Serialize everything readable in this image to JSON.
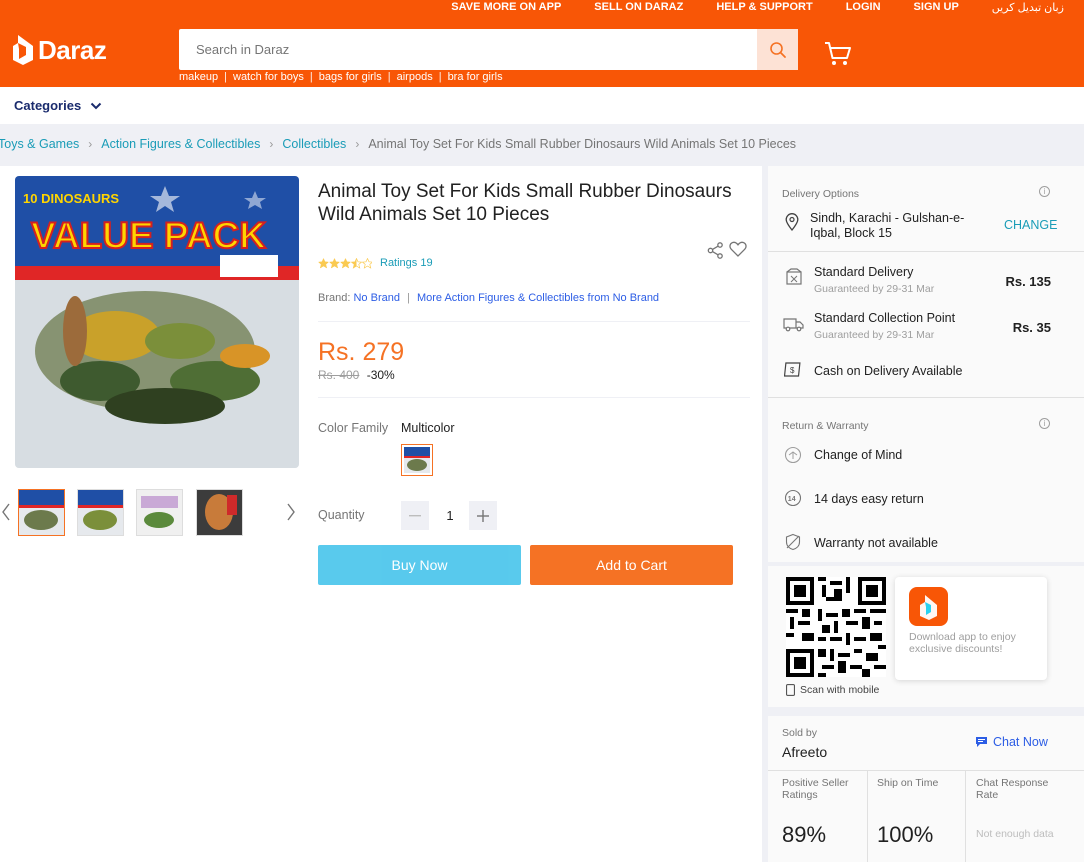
{
  "topnav": {
    "items": [
      "SAVE MORE ON APP",
      "SELL ON DARAZ",
      "HELP & SUPPORT",
      "LOGIN",
      "SIGN UP",
      "زبان تبدیل کریں"
    ]
  },
  "logo": {
    "text": "Daraz"
  },
  "search": {
    "placeholder": "Search in Daraz",
    "value": ""
  },
  "suggestions": [
    "makeup",
    "watch for boys",
    "bags for girls",
    "airpods",
    "bra for girls"
  ],
  "categories": {
    "label": "Categories"
  },
  "breadcrumb": {
    "items": [
      "Toys & Games",
      "Action Figures & Collectibles",
      "Collectibles"
    ],
    "current": "Animal Toy Set For Kids Small Rubber Dinosaurs Wild Animals Set 10 Pieces"
  },
  "product": {
    "title": "Animal Toy Set For Kids Small Rubber Dinosaurs Wild Animals Set 10 Pieces",
    "rating_value": 3.5,
    "ratings_text": "Ratings 19",
    "brand_label": "Brand:",
    "brand_name": "No Brand",
    "brand_more": "More Action Figures & Collectibles from No Brand",
    "price": "Rs. 279",
    "old_price": "Rs. 400",
    "discount": "-30%",
    "color_label": "Color Family",
    "color_value": "Multicolor",
    "quantity_label": "Quantity",
    "quantity": "1",
    "buy_now": "Buy Now",
    "add_to_cart": "Add to Cart",
    "image_text": {
      "top": "10 DINOSAURS",
      "main": "VALUE PACK"
    }
  },
  "delivery": {
    "title": "Delivery Options",
    "location": "Sindh, Karachi - Gulshan-e-Iqbal, Block 15",
    "change": "CHANGE",
    "options": [
      {
        "name": "Standard Delivery",
        "sub": "Guaranteed by 29-31 Mar",
        "price": "Rs. 135"
      },
      {
        "name": "Standard Collection Point",
        "sub": "Guaranteed by 29-31 Mar",
        "price": "Rs. 35"
      }
    ],
    "cod": "Cash on Delivery Available"
  },
  "warranty": {
    "title": "Return & Warranty",
    "items": [
      "Change of Mind",
      "14 days easy return",
      "Warranty not available"
    ]
  },
  "app": {
    "scan": "Scan with mobile",
    "promo": "Download app to enjoy exclusive discounts!"
  },
  "seller": {
    "label": "Sold by",
    "name": "Afreeto",
    "chat": "Chat Now",
    "metrics": [
      {
        "label": "Positive Seller Ratings",
        "value": "89%"
      },
      {
        "label": "Ship on Time",
        "value": "100%"
      },
      {
        "label": "Chat Response Rate",
        "value": "Not enough data"
      }
    ]
  },
  "colors": {
    "brand": "#f85606",
    "accent": "#f57224",
    "link": "#1a9cb7",
    "buy": "#2abbe8"
  }
}
